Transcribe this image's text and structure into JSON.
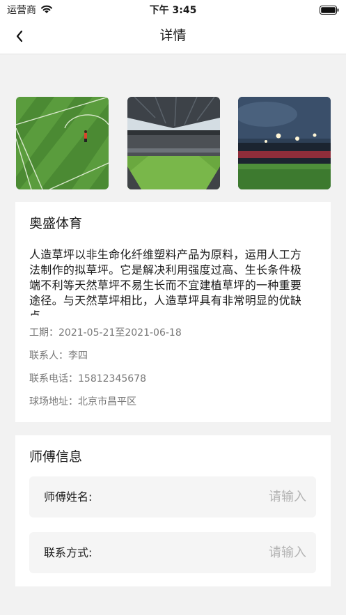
{
  "status_bar": {
    "carrier": "运营商",
    "time": "下午 3:45"
  },
  "nav": {
    "title": "详情"
  },
  "photos": [
    {
      "icon": "football-pitch-photo"
    },
    {
      "icon": "stadium-photo"
    },
    {
      "icon": "stadium-night-photo"
    }
  ],
  "venue": {
    "name": "奥盛体育",
    "description": "人造草坪以非生命化纤维塑料产品为原料，运用人工方法制作的拟草坪。它是解决利用强度过高、生长条件极端不利等天然草坪不易生长而不宜建植草坪的一种重要途径。与天然草坪相比，人造草坪具有非常明显的优缺点。",
    "period": "工期：2021-05-21至2021-06-18",
    "contact": "联系人：李四",
    "phone": "联系电话：15812345678",
    "address": "球场地址：北京市昌平区"
  },
  "master": {
    "title": "师傅信息",
    "name_label": "师傅姓名:",
    "name_placeholder": "请输入",
    "contact_label": "联系方式:",
    "contact_placeholder": "请输入"
  }
}
